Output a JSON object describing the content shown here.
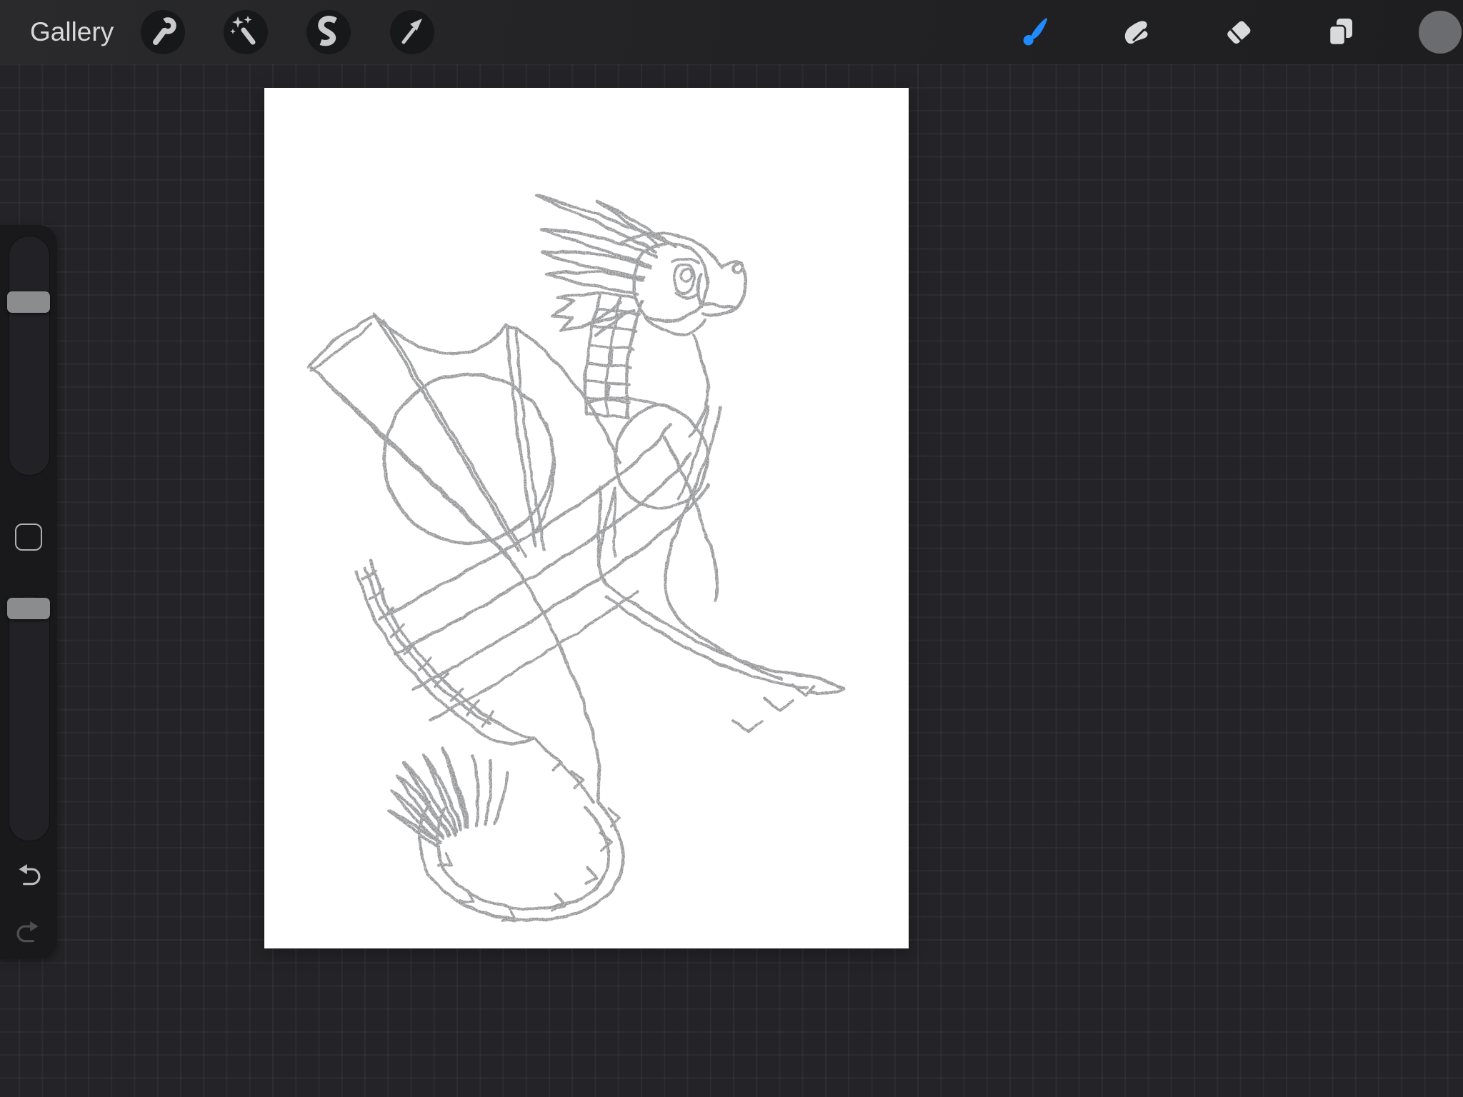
{
  "topbar": {
    "gallery_label": "Gallery",
    "left_tools": [
      {
        "label": "actions",
        "icon": "wrench-icon"
      },
      {
        "label": "adjustments",
        "icon": "magic-wand-icon"
      },
      {
        "label": "selection",
        "icon": "selection-s-icon"
      },
      {
        "label": "transform",
        "icon": "transform-arrow-icon"
      }
    ],
    "right_tools": [
      {
        "label": "paint",
        "icon": "paintbrush-icon",
        "active": true
      },
      {
        "label": "smudge",
        "icon": "smudge-finger-icon",
        "active": false
      },
      {
        "label": "erase",
        "icon": "eraser-icon",
        "active": false
      },
      {
        "label": "layers",
        "icon": "layers-icon",
        "active": false
      },
      {
        "label": "color",
        "icon": "color-swatch-circle",
        "active": false
      }
    ],
    "accent_color": "#1f8bff",
    "inactive_icon_color": "#d9dadc",
    "current_color": "#6b6c6f"
  },
  "sidebar": {
    "brush_size_slider": {
      "value_fraction": 0.75
    },
    "opacity_slider": {
      "value_fraction": 1.0
    },
    "undo": {
      "enabled": true
    },
    "redo": {
      "enabled": false
    },
    "undo_color": "#b9babc",
    "redo_color": "#4f4f53"
  },
  "canvas": {
    "paper_color": "#ffffff",
    "pencil_color": "#8a8b8d",
    "subject": "Hand-drawn pencil sketch of a dragon with a spiny head crest, large bat-like wings, cross-hatched scale bands on neck and tail, long curled tail ending in a spiked tuft"
  },
  "workspace": {
    "background_color": "#242428",
    "grid_line_color": "#2e2f32"
  }
}
